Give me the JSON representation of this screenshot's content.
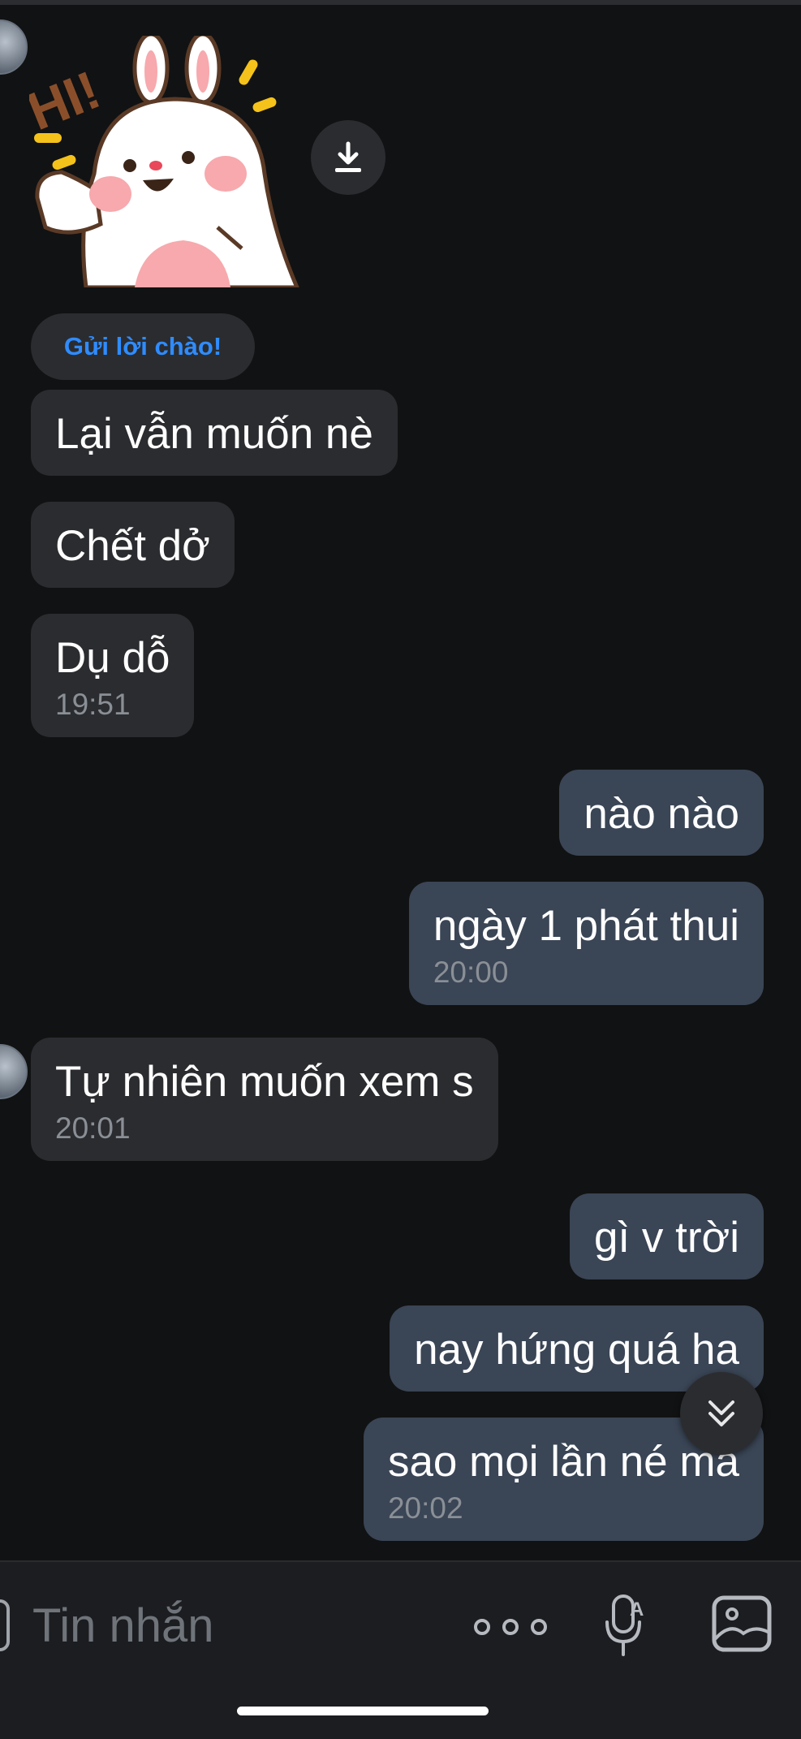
{
  "conversation": {
    "greeting_chip": "Gửi lời chào!",
    "received_group_1": [
      {
        "text": "Lại vẫn muốn nè",
        "time": ""
      },
      {
        "text": "Chết dở",
        "time": ""
      },
      {
        "text": "Dụ dỗ",
        "time": "19:51"
      }
    ],
    "sent_group_1": [
      {
        "text": "nào nào",
        "time": ""
      },
      {
        "text": "ngày 1 phát thui",
        "time": "20:00"
      }
    ],
    "received_group_2": [
      {
        "text": "Tự nhiên muốn xem s",
        "time": "20:01"
      }
    ],
    "sent_group_2": [
      {
        "text": "gì v trời",
        "time": ""
      },
      {
        "text": "nay hứng quá ha",
        "time": ""
      },
      {
        "text": "sao mọi lần né mà",
        "time": "20:02"
      }
    ]
  },
  "composer": {
    "placeholder": "Tin nhắn"
  },
  "icons": {
    "download": "download-icon",
    "scroll_down": "chevron-double-down-icon",
    "more": "more-options-icon",
    "voice": "voice-to-text-icon",
    "image": "image-icon"
  },
  "colors": {
    "background": "#111213",
    "received_bubble": "#2b2c2f",
    "sent_bubble": "#3a4555",
    "accent_link": "#2f8cff",
    "timestamp": "#8a8f96"
  }
}
